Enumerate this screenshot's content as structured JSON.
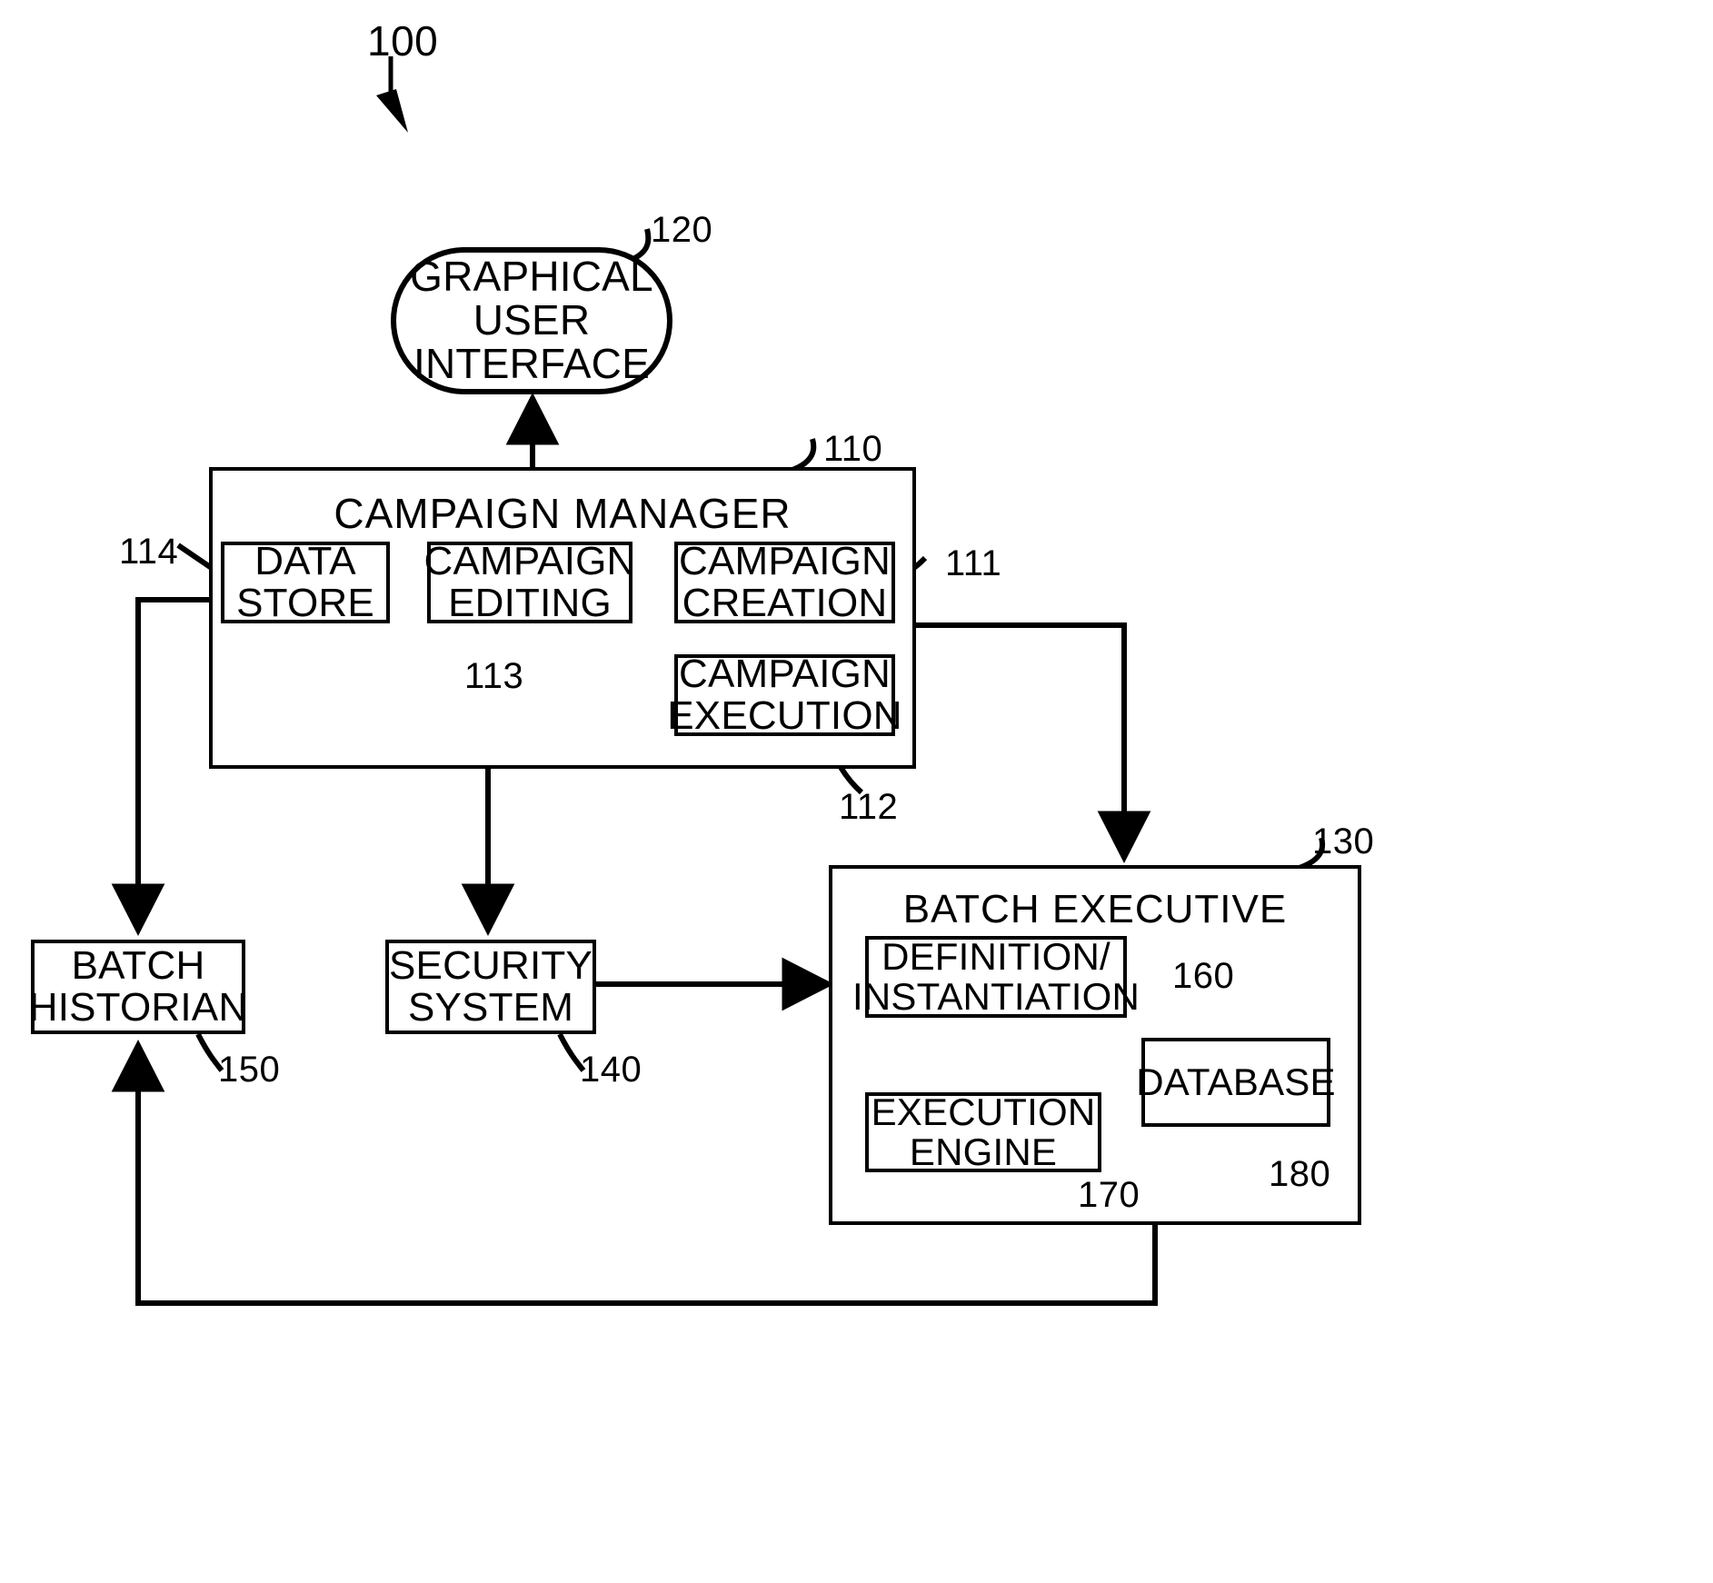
{
  "figure": {
    "figure_ref": "100"
  },
  "nodes": {
    "gui": {
      "line1": "GRAPHICAL",
      "line2": "USER",
      "line3": "INTERFACE",
      "ref": "120"
    },
    "campaign_manager": {
      "title": "CAMPAIGN  MANAGER",
      "ref": "110"
    },
    "data_store": {
      "line1": "DATA",
      "line2": "STORE",
      "ref": "114"
    },
    "campaign_editing": {
      "line1": "CAMPAIGN",
      "line2": "EDITING",
      "ref": "113"
    },
    "campaign_creation": {
      "line1": "CAMPAIGN",
      "line2": "CREATION",
      "ref": "111"
    },
    "campaign_execution": {
      "line1": "CAMPAIGN",
      "line2": "EXECUTION",
      "ref": "112"
    },
    "batch_historian": {
      "line1": "BATCH",
      "line2": "HISTORIAN",
      "ref": "150"
    },
    "security_system": {
      "line1": "SECURITY",
      "line2": "SYSTEM",
      "ref": "140"
    },
    "batch_executive": {
      "title": "BATCH EXECUTIVE",
      "ref": "130"
    },
    "definition_instantiation": {
      "line1": "DEFINITION/",
      "line2": "INSTANTIATION",
      "ref": "160"
    },
    "execution_engine": {
      "line1": "EXECUTION",
      "line2": "ENGINE",
      "ref": "170"
    },
    "database": {
      "line1": "DATABASE",
      "ref": "180"
    }
  },
  "colors": {
    "ink": "#000000",
    "paper": "#ffffff"
  }
}
